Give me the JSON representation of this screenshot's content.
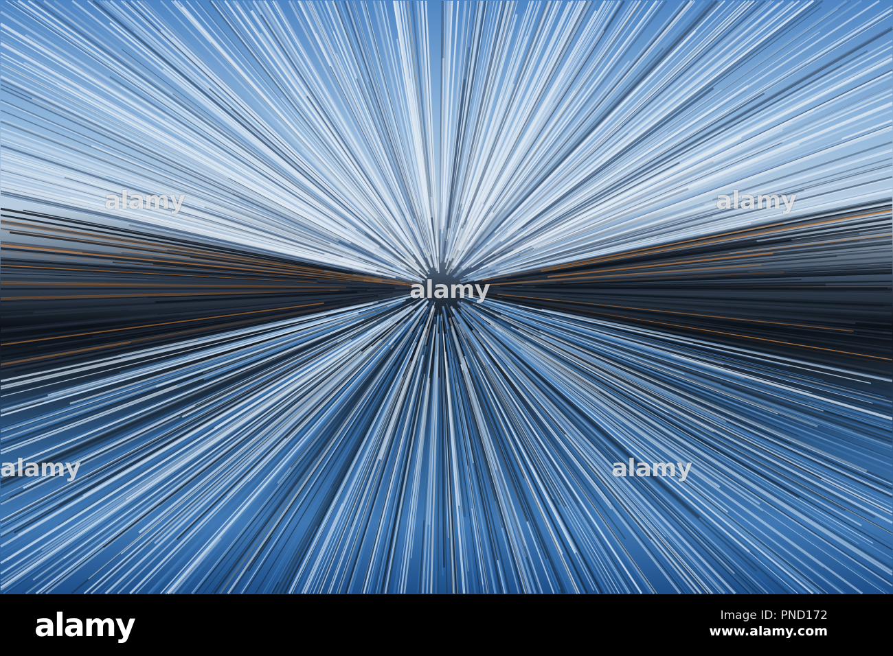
{
  "photo": {
    "description_colors": {
      "sky": "#8fb6dc",
      "dark": "#0c1118",
      "water": "#3f78b4",
      "accent": "#d98a3a"
    },
    "watermark_text": "alamy"
  },
  "footer": {
    "logo": "alamy",
    "image_id": "Image ID: PND172",
    "website": "www.alamy.com"
  }
}
